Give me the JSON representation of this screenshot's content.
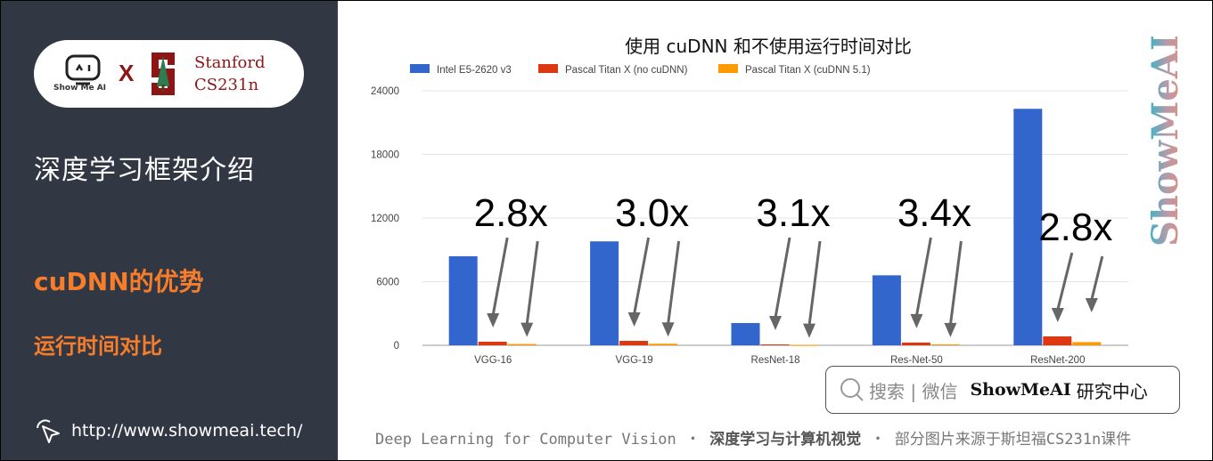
{
  "sidebar": {
    "logo": {
      "showmeai_label": "Show Me AI",
      "x_label": "X",
      "stanford_line1": "Stanford",
      "stanford_line2": "CS231n"
    },
    "title": "深度学习框架介绍",
    "subtitle": "cuDNN的优势",
    "section": "运行时间对比",
    "link": "http://www.showmeai.tech/"
  },
  "watermark": "ShowMeAI",
  "search_box": {
    "placeholder": "搜索 | 微信",
    "brand": "ShowMeAI",
    "suffix": "研究中心"
  },
  "footer": {
    "part1": "Deep Learning for Computer Vision",
    "sep": "・",
    "part2": "深度学习与计算机视觉",
    "part3": "部分图片来源于斯坦福CS231n课件"
  },
  "colors": {
    "intel": "#3366cc",
    "no_cudnn": "#dc3912",
    "cudnn": "#ff9900",
    "sidebar_bg": "#323843",
    "accent": "#f57d2b",
    "stanford": "#8c1515"
  },
  "chart_data": {
    "type": "bar",
    "title": "使用 cuDNN 和不使用运行时间对比",
    "xlabel": "",
    "ylabel": "",
    "categories": [
      "VGG-16",
      "VGG-19",
      "ResNet-18",
      "Res-Net-50",
      "ResNet-200"
    ],
    "series": [
      {
        "name": "Intel E5-2620 v3",
        "color": "#3366cc",
        "values": [
          8400,
          9800,
          2100,
          6600,
          22300
        ]
      },
      {
        "name": "Pascal Titan X (no cuDNN)",
        "color": "#dc3912",
        "values": [
          340,
          420,
          80,
          260,
          840
        ]
      },
      {
        "name": "Pascal Titan X (cuDNN 5.1)",
        "color": "#ff9900",
        "values": [
          120,
          150,
          30,
          90,
          300
        ]
      }
    ],
    "ylim": [
      0,
      24000
    ],
    "yticks": [
      0,
      6000,
      12000,
      18000,
      24000
    ],
    "ytick_labels": [
      "0",
      "6000",
      "12000",
      "18000",
      "24000"
    ],
    "grid": true,
    "legend_position": "top-left",
    "annotations": [
      "2.8x",
      "3.0x",
      "3.1x",
      "3.4x",
      "2.8x"
    ]
  }
}
